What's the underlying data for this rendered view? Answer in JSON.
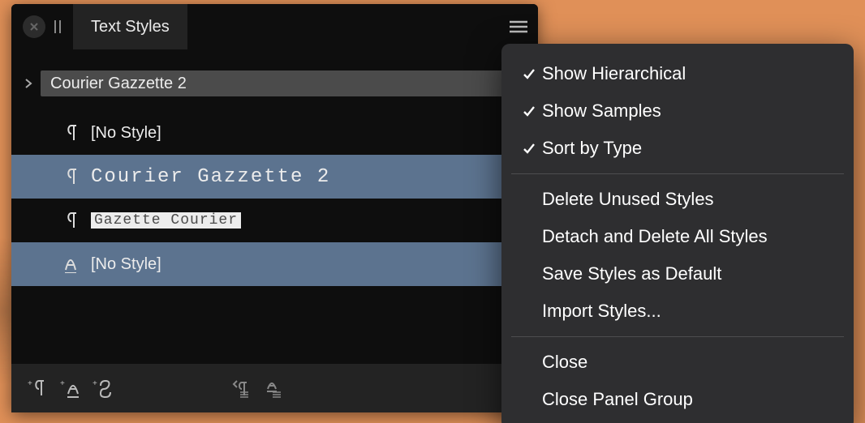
{
  "panel": {
    "tab_label": "Text Styles",
    "group_name": "Courier Gazzette 2"
  },
  "styles": [
    {
      "type": "para",
      "label": "[No Style]",
      "selected": false,
      "mono": false,
      "box": false
    },
    {
      "type": "para",
      "label": "Courier Gazzette 2",
      "selected": true,
      "mono": true,
      "box": false
    },
    {
      "type": "para",
      "label": "Gazette Courier",
      "selected": false,
      "mono": true,
      "box": true
    },
    {
      "type": "char",
      "label": "[No Style]",
      "selected": true,
      "mono": false,
      "box": false
    }
  ],
  "menu": {
    "show_hierarchical": "Show Hierarchical",
    "show_samples": "Show Samples",
    "sort_by_type": "Sort by Type",
    "delete_unused": "Delete Unused Styles",
    "detach_delete_all": "Detach and Delete All Styles",
    "save_default": "Save Styles as Default",
    "import_styles": "Import Styles...",
    "close": "Close",
    "close_group": "Close Panel Group"
  },
  "footer": {
    "add_para": "+¶",
    "add_char": "+a",
    "add_group": "+S"
  }
}
